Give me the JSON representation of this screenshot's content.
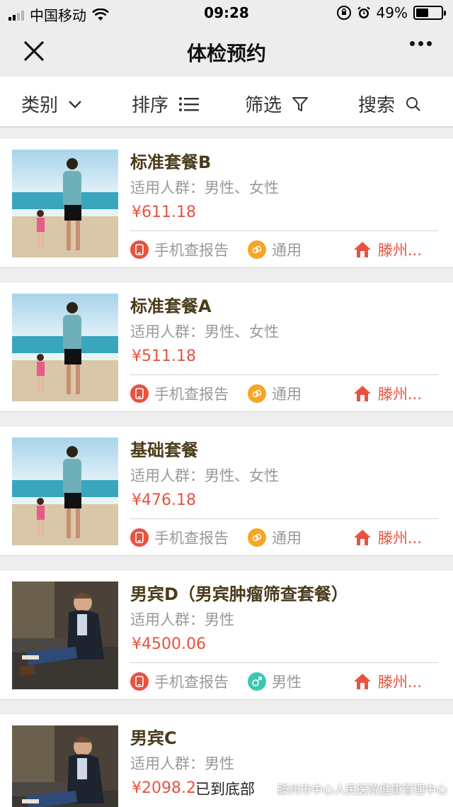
{
  "status_bar": {
    "carrier": "中国移动",
    "time": "09:28",
    "battery_percent": "49%",
    "battery_level": 0.49
  },
  "nav": {
    "title": "体检预约"
  },
  "filters": [
    {
      "label": "类别",
      "icon": "chevron-down-icon"
    },
    {
      "label": "排序",
      "icon": "list-icon"
    },
    {
      "label": "筛选",
      "icon": "funnel-icon"
    },
    {
      "label": "搜索",
      "icon": "search-icon"
    }
  ],
  "packages": [
    {
      "title": "标准套餐B",
      "audience": "适用人群：男性、女性",
      "price": "¥611.18",
      "report_tag": "手机查报告",
      "gender_tag": "通用",
      "location_tag": "滕州...",
      "image": "beach-father-child"
    },
    {
      "title": "标准套餐A",
      "audience": "适用人群：男性、女性",
      "price": "¥511.18",
      "report_tag": "手机查报告",
      "gender_tag": "通用",
      "location_tag": "滕州...",
      "image": "beach-father-child"
    },
    {
      "title": "基础套餐",
      "audience": "适用人群：男性、女性",
      "price": "¥476.18",
      "report_tag": "手机查报告",
      "gender_tag": "通用",
      "location_tag": "滕州...",
      "image": "beach-father-child"
    },
    {
      "title": "男宾D（男宾肿瘤筛查套餐）",
      "audience": "适用人群：男性",
      "price": "¥4500.06",
      "report_tag": "手机查报告",
      "gender_tag": "男性",
      "location_tag": "滕州...",
      "image": "man-on-sofa"
    },
    {
      "title": "男宾C",
      "audience": "适用人群：男性",
      "price": "¥2098.2",
      "image": "man-on-sofa"
    }
  ],
  "footer": {
    "bottom_text": "已到底部",
    "watermark": "滕州市中心人民医院健康管理中心"
  },
  "colors": {
    "price": "#e7533f",
    "title": "#4a3a1a",
    "report_icon": "#e7533f",
    "unisex_icon": "#f5a623",
    "male_icon": "#3cc7b0",
    "location_icon": "#e7533f"
  }
}
